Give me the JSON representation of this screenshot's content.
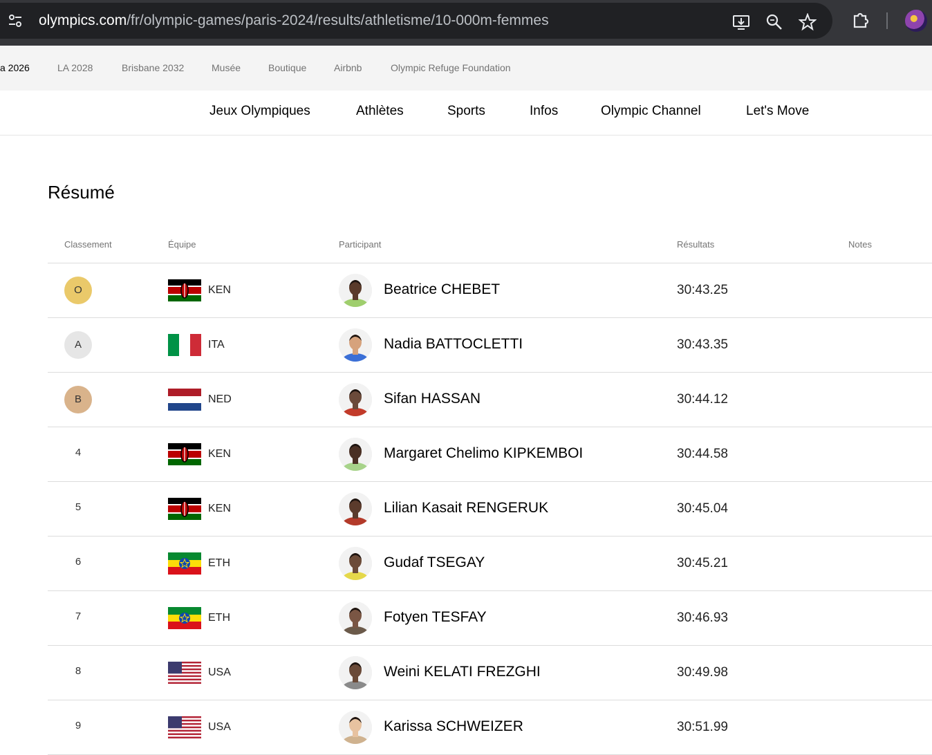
{
  "browser": {
    "url_host": "olympics.com",
    "url_path": "/fr/olympic-games/paris-2024/results/athletisme/10-000m-femmes"
  },
  "subnav": [
    "a 2026",
    "LA 2028",
    "Brisbane 2032",
    "Musée",
    "Boutique",
    "Airbnb",
    "Olympic Refuge Foundation"
  ],
  "mainnav": [
    "Jeux Olympiques",
    "Athlètes",
    "Sports",
    "Infos",
    "Olympic Channel",
    "Let's Move"
  ],
  "section_title": "Résumé",
  "table": {
    "headers": {
      "rank": "Classement",
      "team": "Équipe",
      "participant": "Participant",
      "results": "Résultats",
      "notes": "Notes"
    },
    "rows": [
      {
        "rank": "O",
        "medal": "gold",
        "team": "KEN",
        "flag": "kenya",
        "name": "Beatrice CHEBET",
        "result": "30:43.25"
      },
      {
        "rank": "A",
        "medal": "silver",
        "team": "ITA",
        "flag": "italy",
        "name": "Nadia BATTOCLETTI",
        "result": "30:43.35"
      },
      {
        "rank": "B",
        "medal": "bronze",
        "team": "NED",
        "flag": "netherlands",
        "name": "Sifan HASSAN",
        "result": "30:44.12"
      },
      {
        "rank": "4",
        "medal": "",
        "team": "KEN",
        "flag": "kenya",
        "name": "Margaret Chelimo KIPKEMBOI",
        "result": "30:44.58"
      },
      {
        "rank": "5",
        "medal": "",
        "team": "KEN",
        "flag": "kenya",
        "name": "Lilian Kasait RENGERUK",
        "result": "30:45.04"
      },
      {
        "rank": "6",
        "medal": "",
        "team": "ETH",
        "flag": "ethiopia",
        "name": "Gudaf TSEGAY",
        "result": "30:45.21"
      },
      {
        "rank": "7",
        "medal": "",
        "team": "ETH",
        "flag": "ethiopia",
        "name": "Fotyen TESFAY",
        "result": "30:46.93"
      },
      {
        "rank": "8",
        "medal": "",
        "team": "USA",
        "flag": "usa",
        "name": "Weini KELATI FREZGHI",
        "result": "30:49.98"
      },
      {
        "rank": "9",
        "medal": "",
        "team": "USA",
        "flag": "usa",
        "name": "Karissa SCHWEIZER",
        "result": "30:51.99"
      }
    ]
  },
  "colors": {
    "gold": "#eac96a",
    "silver": "#e6e6e6",
    "bronze": "#d9b38b"
  }
}
